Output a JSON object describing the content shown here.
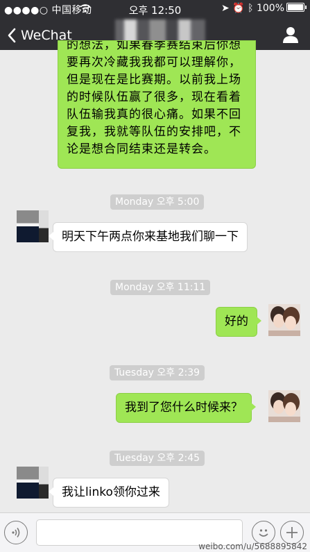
{
  "status_bar": {
    "carrier": "●●●●○ 中国移动",
    "time": "오후 12:50",
    "battery": "100%"
  },
  "nav": {
    "back_label": "WeChat"
  },
  "messages": {
    "m1_text": "的想法，如果春季赛结束后你想要再次冷藏我我都可以理解你，但是现在是比赛期。以前我上场的时候队伍赢了很多，现在看着队伍输我真的很心痛。如果不回复我，我就等队伍的安排吧，不论是想合同结束还是转会。",
    "t1": "Monday 오후 5:00",
    "m2_text": "明天下午两点你来基地我们聊一下",
    "t2": "Monday 오후 11:11",
    "m3_text": "好的",
    "t3": "Tuesday 오후 2:39",
    "m4_text": "我到了您什么时候来？",
    "t4": "Tuesday 오후 2:45",
    "m5_text": "我让linko领你过来"
  },
  "watermark": "weibo.com/u/5688895842",
  "colors": {
    "nav_bg": "#2f2f33",
    "chat_bg": "#ebebeb",
    "outgoing_bubble": "#9fe655",
    "incoming_bubble": "#ffffff",
    "timestamp_bg": "#cecece"
  },
  "icons": {
    "back": "chevron-left-icon",
    "profile": "person-icon",
    "voice": "voice-icon",
    "emoji": "emoji-icon",
    "more": "plus-icon"
  }
}
